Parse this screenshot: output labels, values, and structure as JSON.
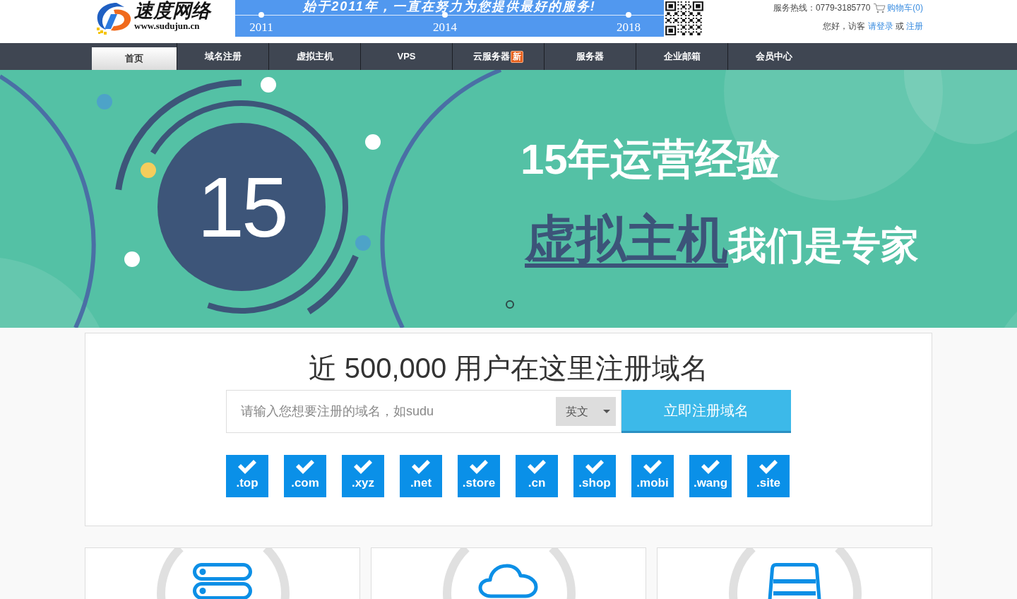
{
  "header": {
    "logo": {
      "name": "速度网络",
      "url": "www.sudujun.cn"
    },
    "timeline": {
      "slogan": "始于2011年，一直在努力为您提供最好的服务!",
      "milestones": [
        "2011",
        "2014",
        "2018"
      ]
    },
    "contact": {
      "hotline": "服务热线：0779-3185770",
      "cart": "购物车(0)",
      "greeting": "您好，访客",
      "login": "请登录",
      "conjunction": "或",
      "register": "注册"
    }
  },
  "nav": [
    {
      "label": "首页",
      "selected": true
    },
    {
      "label": "域名注册",
      "selected": false
    },
    {
      "label": "虚拟主机",
      "selected": false
    },
    {
      "label": "VPS",
      "selected": false
    },
    {
      "label": "云服务器",
      "badge": "新",
      "selected": false
    },
    {
      "label": "服务器",
      "selected": false
    },
    {
      "label": "企业邮箱",
      "selected": false
    },
    {
      "label": "会员中心",
      "selected": false
    }
  ],
  "banner": {
    "number": "15",
    "headline": "15年运营经验",
    "highlight": "虚拟主机",
    "tagline": "我们是专家",
    "slide_dots": [
      {
        "selected": true
      }
    ]
  },
  "domain_search": {
    "title": "近 500,000 用户在这里注册域名",
    "input": {
      "placeholder": "请输入您想要注册的域名，如sudu"
    },
    "language": "英文",
    "submit": "立即注册域名",
    "extensions": [
      {
        "label": ".top",
        "checked": true
      },
      {
        "label": ".com",
        "checked": true
      },
      {
        "label": ".xyz",
        "checked": true
      },
      {
        "label": ".net",
        "checked": true
      },
      {
        "label": ".store",
        "checked": true
      },
      {
        "label": ".cn",
        "checked": true
      },
      {
        "label": ".shop",
        "checked": true
      },
      {
        "label": ".mobi",
        "checked": true
      },
      {
        "label": ".wang",
        "checked": true
      },
      {
        "label": ".site",
        "checked": true
      }
    ]
  }
}
